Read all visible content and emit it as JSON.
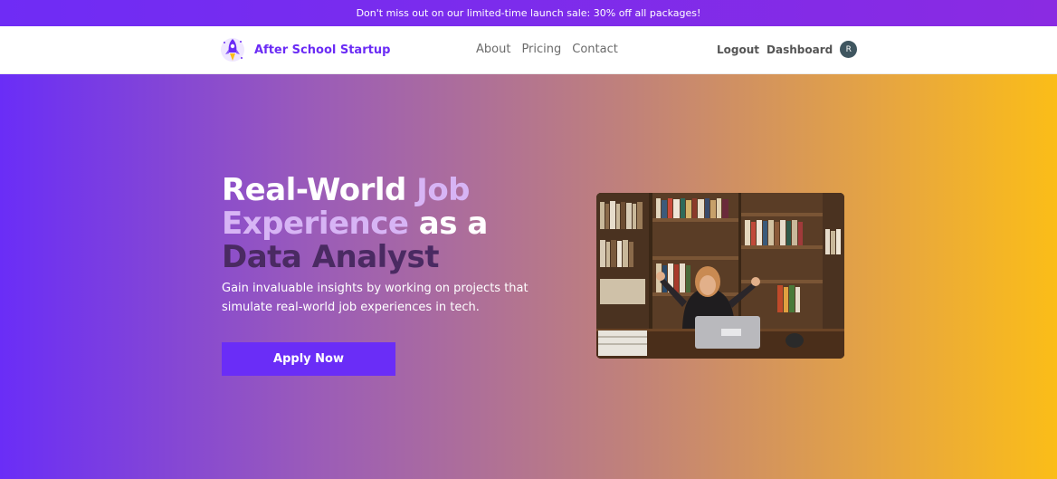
{
  "promo": {
    "text": "Don't miss out on our limited-time launch sale: 30% off all packages!"
  },
  "nav": {
    "brand": "After School Startup",
    "links": [
      "About",
      "Pricing",
      "Contact"
    ],
    "logout": "Logout",
    "dashboard": "Dashboard",
    "avatar_initial": "R"
  },
  "hero": {
    "headline": {
      "part1": "Real-World ",
      "part2": "Job",
      "part3": "Experience",
      "part4": " as a",
      "part5": "Data Analyst"
    },
    "subtext": "Gain invaluable insights by working on projects that simulate real-world job experiences in tech.",
    "cta": "Apply Now",
    "image": "person-at-laptop-in-library"
  },
  "colors": {
    "brand_purple": "#6a2df7",
    "accent_lilac": "#d7b4f5",
    "dark_purple": "#4a2a62",
    "gradient_end": "#fbbd18"
  }
}
